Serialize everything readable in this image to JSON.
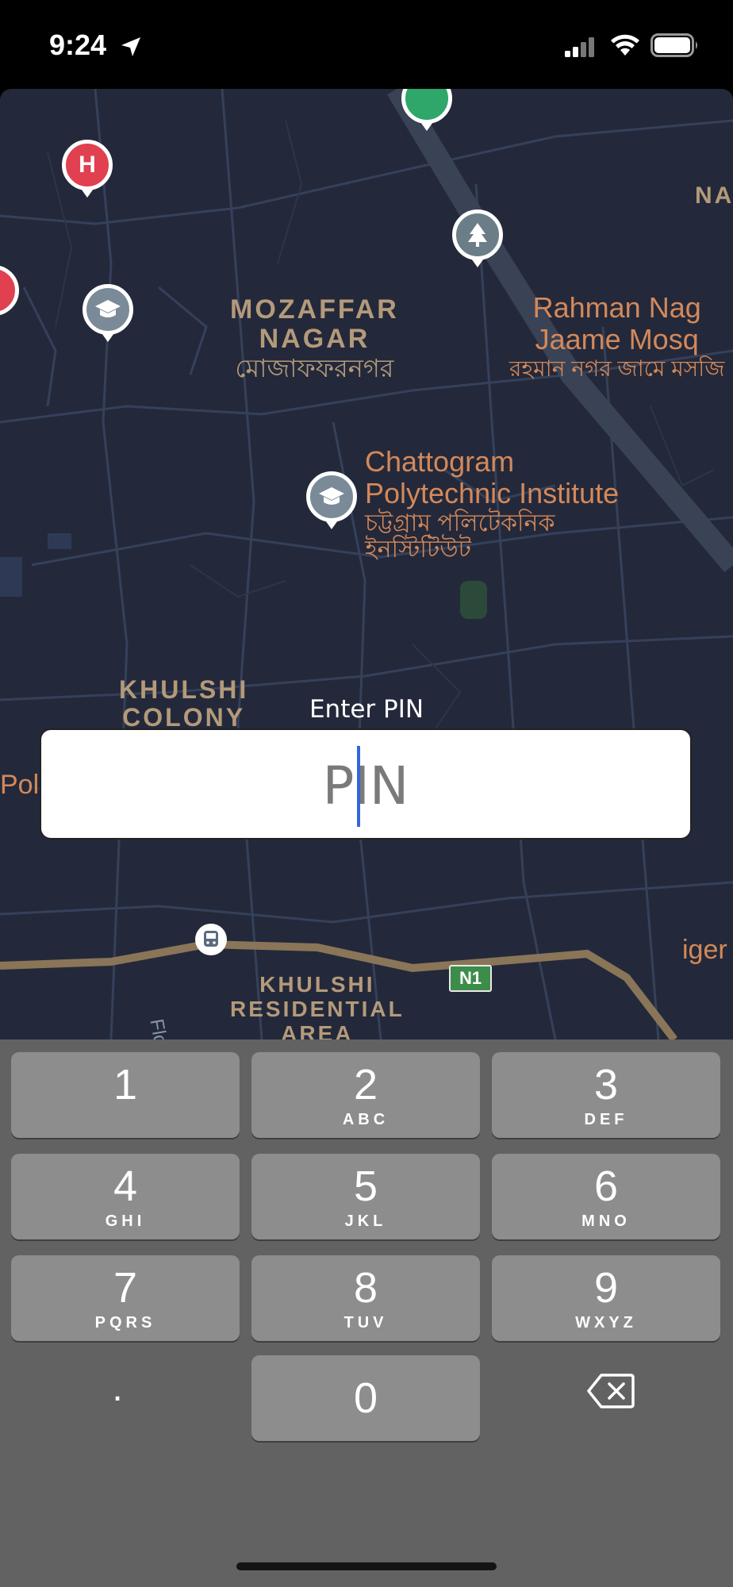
{
  "status_bar": {
    "time": "9:24",
    "icons": [
      "location-arrow-icon",
      "cellular-signal-icon",
      "wifi-icon",
      "battery-icon"
    ]
  },
  "map": {
    "area_labels": [
      {
        "text": "MOZAFFAR\nNAGAR",
        "bn": "মোজাফফরনগর"
      },
      {
        "text": "KHULSHI\nCOLONY"
      },
      {
        "text": "KHULSHI\nRESIDENTIAL\nAREA"
      },
      {
        "text": "NA"
      }
    ],
    "poi_labels": [
      {
        "en": "Chattogram\nPolytechnic Institute",
        "bn": "চট্টগ্রাম পলিটেকনিক\nইনস্টিটিউট"
      },
      {
        "en": "Rahman Nag\nJaame Mosq",
        "bn": "রহমান নগর জামে মসজি"
      },
      {
        "en": "Pol"
      },
      {
        "en": "iger"
      }
    ],
    "road_labels": {
      "highway": "N1",
      "street": "Flora P"
    },
    "pins": [
      "hospital-pin",
      "education-pin",
      "park-pin",
      "green-pin",
      "bus-stop-pin"
    ],
    "colors": {
      "background": "#23293a",
      "roads": "#35405a",
      "highway": "#8a7558",
      "label": "#d4885a"
    }
  },
  "pin_entry": {
    "caption": "Enter PIN",
    "placeholder": "PIN",
    "value": ""
  },
  "keypad": {
    "keys": [
      {
        "digit": "1",
        "letters": ""
      },
      {
        "digit": "2",
        "letters": "ABC"
      },
      {
        "digit": "3",
        "letters": "DEF"
      },
      {
        "digit": "4",
        "letters": "GHI"
      },
      {
        "digit": "5",
        "letters": "JKL"
      },
      {
        "digit": "6",
        "letters": "MNO"
      },
      {
        "digit": "7",
        "letters": "PQRS"
      },
      {
        "digit": "8",
        "letters": "TUV"
      },
      {
        "digit": "9",
        "letters": "WXYZ"
      },
      {
        "digit": "0",
        "letters": ""
      }
    ],
    "decimal": ".",
    "delete_icon": "backspace-icon"
  }
}
